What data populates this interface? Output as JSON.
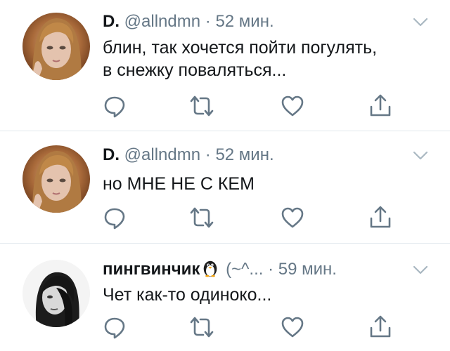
{
  "colors": {
    "text": "#14171a",
    "secondary": "#657786",
    "icon": "#657786",
    "divider": "#e1e8ed",
    "background": "#ffffff"
  },
  "tweets": [
    {
      "name": "D.",
      "handle": "@allndmn",
      "dot": "·",
      "time": "52 мин.",
      "text": "блин, так хочется пойти погулять,\nв снежку поваляться...",
      "avatar_icon": "avatar-girl-light-hair"
    },
    {
      "name": "D.",
      "handle": "@allndmn",
      "dot": "·",
      "time": "52 мин.",
      "text": "но МНЕ НЕ С КЕМ",
      "avatar_icon": "avatar-girl-light-hair"
    },
    {
      "name": "пингвинчик",
      "emoji": "penguin-emoji",
      "handle": "(~^...",
      "dot": "·",
      "time": "59 мин.",
      "text": "Чет как-то одиноко...",
      "avatar_icon": "avatar-girl-bw"
    }
  ],
  "action_icons": [
    "reply-icon",
    "retweet-icon",
    "like-icon",
    "share-icon"
  ],
  "menu_icon": "chevron-down-icon"
}
